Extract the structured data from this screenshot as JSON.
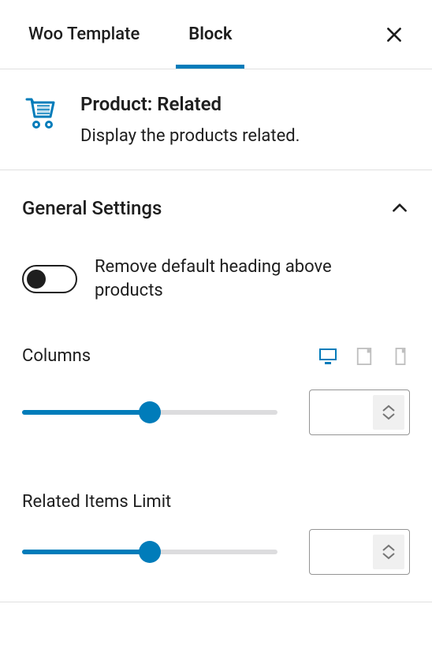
{
  "tabs": {
    "template": "Woo Template",
    "block": "Block"
  },
  "block_card": {
    "title": "Product: Related",
    "description": "Display the products related."
  },
  "section": {
    "title": "General Settings"
  },
  "toggle": {
    "label": "Remove default heading above products",
    "checked": false
  },
  "columns": {
    "label": "Columns",
    "value": "",
    "slider_percent": 50
  },
  "related_limit": {
    "label": "Related Items Limit",
    "value": "",
    "slider_percent": 50
  },
  "colors": {
    "accent": "#007cba"
  }
}
